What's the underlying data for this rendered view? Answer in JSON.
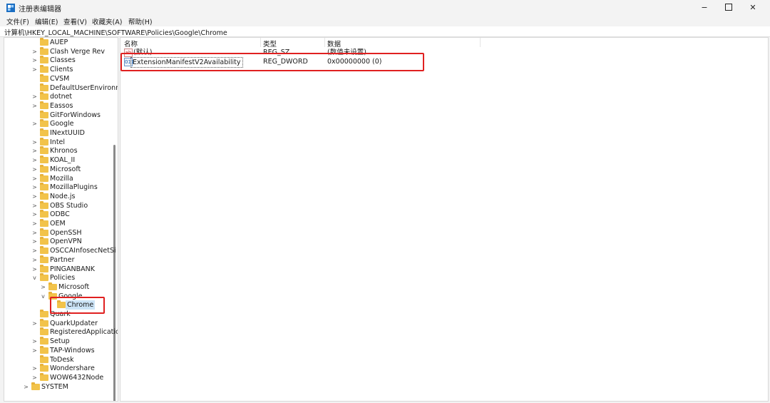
{
  "window": {
    "title": "注册表编辑器",
    "buttons": {
      "minimize": "−",
      "maximize": "",
      "close": "✕"
    }
  },
  "menu": [
    "文件(F)",
    "编辑(E)",
    "查看(V)",
    "收藏夹(A)",
    "帮助(H)"
  ],
  "address": "计算机\\HKEY_LOCAL_MACHINE\\SOFTWARE\\Policies\\Google\\Chrome",
  "tree": [
    {
      "label": "AUEP",
      "level": 2,
      "expander": ""
    },
    {
      "label": "Clash Verge Rev",
      "level": 2,
      "expander": ">"
    },
    {
      "label": "Classes",
      "level": 2,
      "expander": ">"
    },
    {
      "label": "Clients",
      "level": 2,
      "expander": ">"
    },
    {
      "label": "CVSM",
      "level": 2,
      "expander": ""
    },
    {
      "label": "DefaultUserEnvironm",
      "level": 2,
      "expander": ""
    },
    {
      "label": "dotnet",
      "level": 2,
      "expander": ">"
    },
    {
      "label": "Eassos",
      "level": 2,
      "expander": ">"
    },
    {
      "label": "GitForWindows",
      "level": 2,
      "expander": ""
    },
    {
      "label": "Google",
      "level": 2,
      "expander": ">"
    },
    {
      "label": "INextUUID",
      "level": 2,
      "expander": ""
    },
    {
      "label": "Intel",
      "level": 2,
      "expander": ">"
    },
    {
      "label": "Khronos",
      "level": 2,
      "expander": ">"
    },
    {
      "label": "KOAL_II",
      "level": 2,
      "expander": ">"
    },
    {
      "label": "Microsoft",
      "level": 2,
      "expander": ">"
    },
    {
      "label": "Mozilla",
      "level": 2,
      "expander": ">"
    },
    {
      "label": "MozillaPlugins",
      "level": 2,
      "expander": ">"
    },
    {
      "label": "Node.js",
      "level": 2,
      "expander": ">"
    },
    {
      "label": "OBS Studio",
      "level": 2,
      "expander": ">"
    },
    {
      "label": "ODBC",
      "level": 2,
      "expander": ">"
    },
    {
      "label": "OEM",
      "level": 2,
      "expander": ">"
    },
    {
      "label": "OpenSSH",
      "level": 2,
      "expander": ">"
    },
    {
      "label": "OpenVPN",
      "level": 2,
      "expander": ">"
    },
    {
      "label": "OSCCAInfosecNetSi",
      "level": 2,
      "expander": ">"
    },
    {
      "label": "Partner",
      "level": 2,
      "expander": ">"
    },
    {
      "label": "PINGANBANK",
      "level": 2,
      "expander": ">"
    },
    {
      "label": "Policies",
      "level": 2,
      "expander": "v"
    },
    {
      "label": "Microsoft",
      "level": 3,
      "expander": ">"
    },
    {
      "label": "Google",
      "level": 3,
      "expander": "v"
    },
    {
      "label": "Chrome",
      "level": 4,
      "expander": "",
      "selected": true
    },
    {
      "label": "Quark",
      "level": 2,
      "expander": ""
    },
    {
      "label": "QuarkUpdater",
      "level": 2,
      "expander": ">"
    },
    {
      "label": "RegisteredApplicatio",
      "level": 2,
      "expander": ""
    },
    {
      "label": "Setup",
      "level": 2,
      "expander": ">"
    },
    {
      "label": "TAP-Windows",
      "level": 2,
      "expander": ">"
    },
    {
      "label": "ToDesk",
      "level": 2,
      "expander": ""
    },
    {
      "label": "Wondershare",
      "level": 2,
      "expander": ">"
    },
    {
      "label": "WOW6432Node",
      "level": 2,
      "expander": ">"
    },
    {
      "label": "SYSTEM",
      "level": 1,
      "expander": ">"
    }
  ],
  "columns": {
    "name": "名称",
    "type": "类型",
    "data": "数据"
  },
  "values": [
    {
      "icon": "ab",
      "icon_kind": "string-value-icon",
      "name": "(默认)",
      "type": "REG_SZ",
      "data": "(数值未设置)"
    },
    {
      "icon": "011",
      "icon_kind": "dword-value-icon",
      "name": "ExtensionManifestV2Availability",
      "type": "REG_DWORD",
      "data": "0x00000000 (0)",
      "focused": true
    }
  ],
  "colors": {
    "highlight": "#e02020",
    "folder": "#f2c34a",
    "selection": "#cce4f7"
  }
}
